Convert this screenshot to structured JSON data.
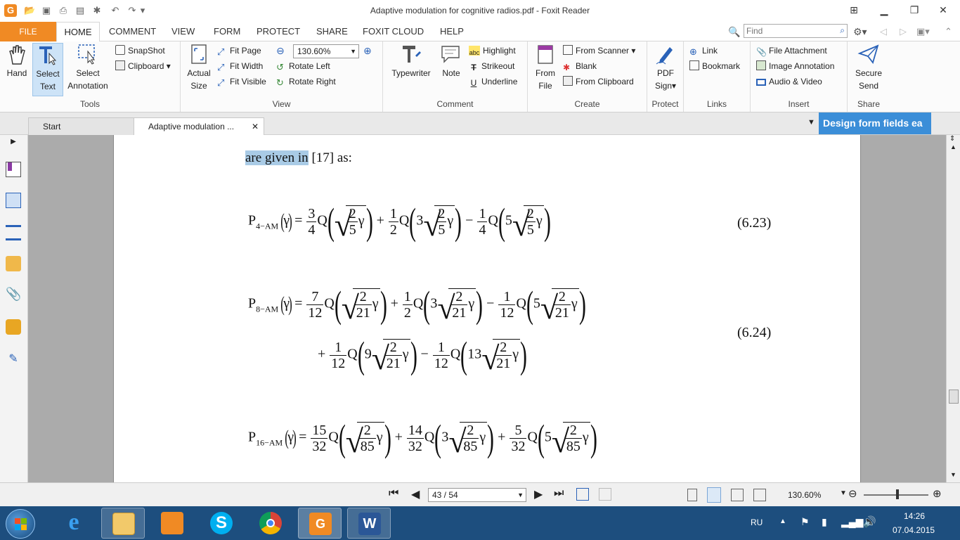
{
  "window": {
    "title": "Adaptive modulation for cognitive radios.pdf - Foxit Reader",
    "app_icon": "G"
  },
  "menu": {
    "file": "FILE",
    "tabs": [
      "HOME",
      "COMMENT",
      "VIEW",
      "FORM",
      "PROTECT",
      "SHARE",
      "FOXIT CLOUD",
      "HELP"
    ]
  },
  "find": {
    "placeholder": "Find"
  },
  "ribbon": {
    "tools": {
      "label": "Tools",
      "hand": "Hand",
      "select_text": [
        "Select",
        "Text"
      ],
      "select_annotation": [
        "Select",
        "Annotation"
      ],
      "snapshot": "SnapShot",
      "clipboard": "Clipboard"
    },
    "view": {
      "label": "View",
      "actual_size": [
        "Actual",
        "Size"
      ],
      "fit_page": "Fit Page",
      "fit_width": "Fit Width",
      "fit_visible": "Fit Visible",
      "zoom": "130.60%",
      "rotate_left": "Rotate Left",
      "rotate_right": "Rotate Right"
    },
    "comment": {
      "label": "Comment",
      "typewriter": "Typewriter",
      "note": "Note",
      "highlight": "Highlight",
      "strikeout": "Strikeout",
      "underline": "Underline"
    },
    "create": {
      "label": "Create",
      "from_file": [
        "From",
        "File"
      ],
      "from_scanner": "From Scanner",
      "blank": "Blank",
      "from_clipboard": "From Clipboard"
    },
    "protect": {
      "label": "Protect",
      "pdf_sign": [
        "PDF",
        "Sign"
      ]
    },
    "links": {
      "label": "Links",
      "link": "Link",
      "bookmark": "Bookmark"
    },
    "insert": {
      "label": "Insert",
      "file_attachment": "File Attachment",
      "image_annotation": "Image Annotation",
      "audio_video": "Audio & Video"
    },
    "share": {
      "label": "Share",
      "secure_send": [
        "Secure",
        "Send"
      ]
    }
  },
  "doc_tabs": {
    "start": "Start",
    "current": "Adaptive modulation ...",
    "banner": "Design form fields ea"
  },
  "document": {
    "intro_highlighted": "are given in",
    "intro_rest": " [17] as:",
    "eq_6_23": {
      "lhs": "P",
      "lhs_sub": "4−AM",
      "gamma": "γ",
      "number": "(6.23)",
      "c1": [
        "3",
        "4"
      ],
      "c2": [
        "1",
        "2"
      ],
      "c3": [
        "1",
        "4"
      ],
      "k2": "3",
      "k3": "5",
      "root": [
        "2",
        "5"
      ]
    },
    "eq_6_24": {
      "lhs": "P",
      "lhs_sub": "8−AM",
      "number": "(6.24)",
      "c1": [
        "7",
        "12"
      ],
      "c2": [
        "1",
        "2"
      ],
      "c3": [
        "1",
        "12"
      ],
      "c4": [
        "1",
        "12"
      ],
      "c5": [
        "1",
        "12"
      ],
      "k2": "3",
      "k3": "5",
      "k4": "9",
      "k5": "13",
      "root": [
        "2",
        "21"
      ]
    },
    "eq_6_25": {
      "lhs": "P",
      "lhs_sub": "16−AM",
      "c1": [
        "15",
        "32"
      ],
      "c2": [
        "14",
        "32"
      ],
      "c3": [
        "5",
        "32"
      ],
      "k2": "3",
      "k3": "5",
      "root": [
        "2",
        "85"
      ]
    },
    "Q": "Q",
    "eq": "=",
    "plus": "+",
    "minus": "−"
  },
  "status": {
    "page": "43 / 54",
    "zoom": "130.60%"
  },
  "tray": {
    "lang": "RU",
    "time": "14:26",
    "date": "07.04.2015"
  },
  "colors": {
    "accent": "#f08a24",
    "taskbar": "#1d4e7e",
    "highlight": "#a9cbe6",
    "banner": "#3b8ed8"
  }
}
